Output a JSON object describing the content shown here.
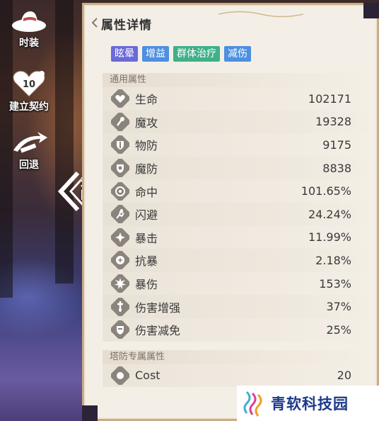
{
  "sidebar": {
    "items": [
      {
        "label": "时装",
        "icon": "hat-icon"
      },
      {
        "label": "建立契约",
        "icon": "heart-badge-icon",
        "badge": "10"
      },
      {
        "label": "回退",
        "icon": "rewind-icon"
      }
    ]
  },
  "back": {
    "label": "返回"
  },
  "panel": {
    "title": "属性详情",
    "tags": [
      {
        "label": "眩晕",
        "color": "#6a6ad8"
      },
      {
        "label": "增益",
        "color": "#4d8fe0"
      },
      {
        "label": "群体治疗",
        "color": "#3fb08a"
      },
      {
        "label": "减伤",
        "color": "#4d8fe0"
      }
    ],
    "general_section": "通用属性",
    "stats": [
      {
        "name": "生命",
        "value": "102171",
        "icon": "heart-icon"
      },
      {
        "name": "魔攻",
        "value": "19328",
        "icon": "wand-icon"
      },
      {
        "name": "物防",
        "value": "9175",
        "icon": "shield-sword-icon"
      },
      {
        "name": "魔防",
        "value": "8838",
        "icon": "shield-magic-icon"
      },
      {
        "name": "命中",
        "value": "101.65%",
        "icon": "target-icon"
      },
      {
        "name": "闪避",
        "value": "24.24%",
        "icon": "dodge-icon"
      },
      {
        "name": "暴击",
        "value": "11.99%",
        "icon": "burst-icon"
      },
      {
        "name": "抗暴",
        "value": "2.18%",
        "icon": "burst-resist-icon"
      },
      {
        "name": "暴伤",
        "value": "153%",
        "icon": "crit-damage-icon"
      },
      {
        "name": "伤害增强",
        "value": "37%",
        "icon": "damage-up-icon"
      },
      {
        "name": "伤害减免",
        "value": "25%",
        "icon": "damage-reduce-icon"
      }
    ],
    "tower_section": "塔防专属属性",
    "tower_stats": [
      {
        "name": "Cost",
        "value": "20",
        "icon": "cost-icon"
      }
    ]
  },
  "watermark": {
    "text": "青软科技园"
  }
}
